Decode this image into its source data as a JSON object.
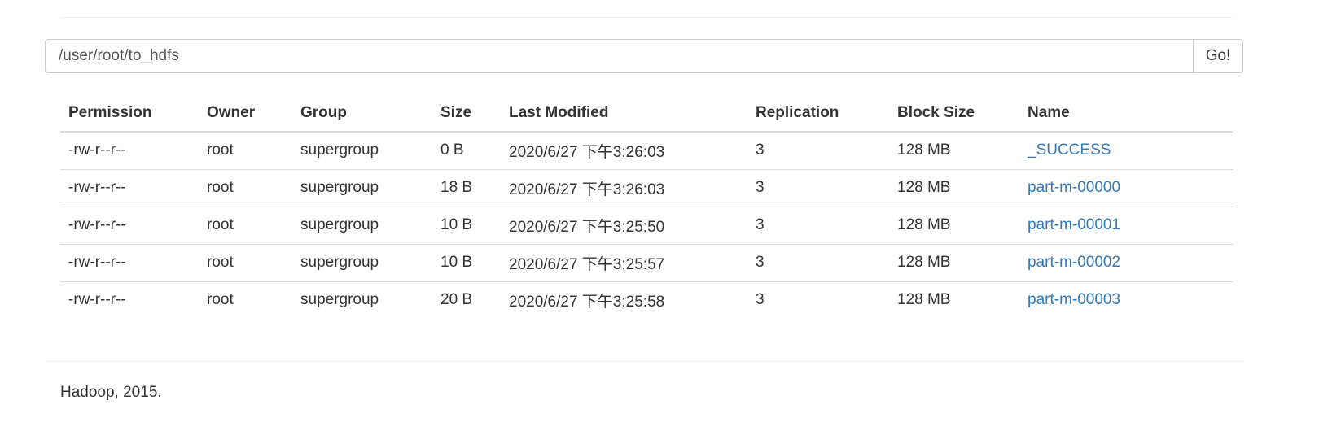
{
  "path_bar": {
    "value": "/user/root/to_hdfs",
    "go_label": "Go!"
  },
  "table": {
    "headers": {
      "permission": "Permission",
      "owner": "Owner",
      "group": "Group",
      "size": "Size",
      "last_modified": "Last Modified",
      "replication": "Replication",
      "block_size": "Block Size",
      "name": "Name"
    },
    "rows": [
      {
        "permission": "-rw-r--r--",
        "owner": "root",
        "group": "supergroup",
        "size": "0 B",
        "last_modified": "2020/6/27 下午3:26:03",
        "replication": "3",
        "block_size": "128 MB",
        "name": "_SUCCESS"
      },
      {
        "permission": "-rw-r--r--",
        "owner": "root",
        "group": "supergroup",
        "size": "18 B",
        "last_modified": "2020/6/27 下午3:26:03",
        "replication": "3",
        "block_size": "128 MB",
        "name": "part-m-00000"
      },
      {
        "permission": "-rw-r--r--",
        "owner": "root",
        "group": "supergroup",
        "size": "10 B",
        "last_modified": "2020/6/27 下午3:25:50",
        "replication": "3",
        "block_size": "128 MB",
        "name": "part-m-00001"
      },
      {
        "permission": "-rw-r--r--",
        "owner": "root",
        "group": "supergroup",
        "size": "10 B",
        "last_modified": "2020/6/27 下午3:25:57",
        "replication": "3",
        "block_size": "128 MB",
        "name": "part-m-00002"
      },
      {
        "permission": "-rw-r--r--",
        "owner": "root",
        "group": "supergroup",
        "size": "20 B",
        "last_modified": "2020/6/27 下午3:25:58",
        "replication": "3",
        "block_size": "128 MB",
        "name": "part-m-00003"
      }
    ]
  },
  "footer": {
    "text": "Hadoop, 2015."
  },
  "colors": {
    "link": "#337ab7",
    "text": "#333333",
    "border": "#dddddd"
  }
}
